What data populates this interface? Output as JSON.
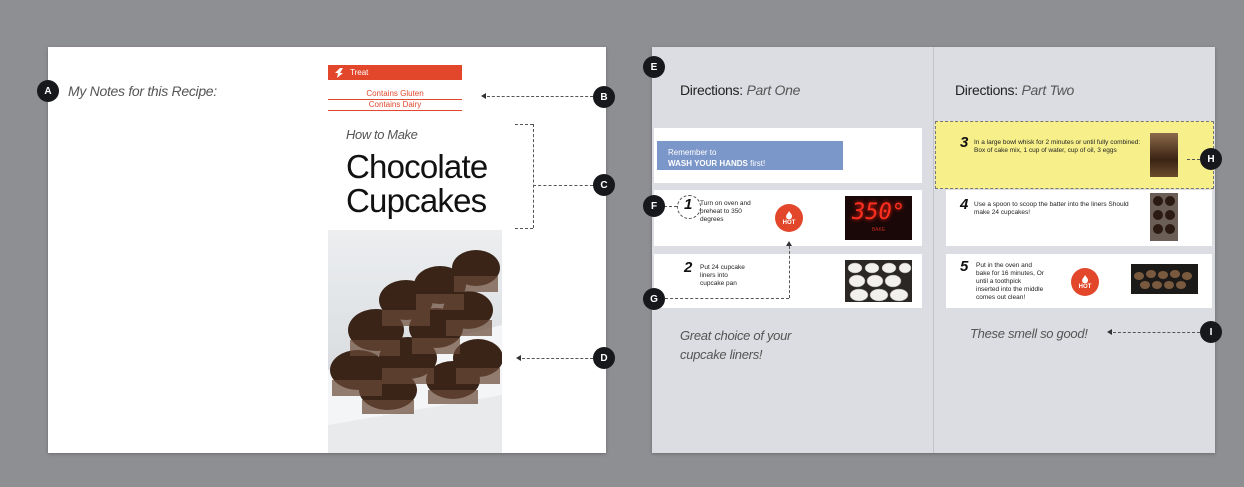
{
  "callouts": {
    "a": "A",
    "b": "B",
    "c": "C",
    "d": "D",
    "e": "E",
    "f": "F",
    "g": "G",
    "h": "H",
    "i": "I"
  },
  "left_page": {
    "notes_heading": "My Notes for this Recipe:"
  },
  "tags": {
    "treat": "Treat",
    "gluten": "Contains Gluten",
    "dairy": "Contains Dairy"
  },
  "title": {
    "how_to": "How to Make",
    "line1": "Chocolate",
    "line2": "Cupcakes"
  },
  "directions_one": {
    "title_main": "Directions:",
    "title_part": "Part One",
    "remember_line1": "Remember to",
    "remember_bold": "WASH YOUR HANDS",
    "remember_rest": "first!",
    "step1_num": "1",
    "step1_text": "Turn on oven and preheat to 350 degrees",
    "hot": "HOT",
    "oven_display": "350°",
    "oven_sub": "BAKE",
    "step2_num": "2",
    "step2_text": "Put 24 cupcake liners into cupcake pan",
    "note": "Great choice of your cupcake liners!"
  },
  "directions_two": {
    "title_main": "Directions:",
    "title_part": "Part Two",
    "step3_num": "3",
    "step3_text": "In a large bowl whisk for 2 minutes or until fully combined: Box of cake mix, 1   cup of water,   cup of oil, 3 eggs",
    "step4_num": "4",
    "step4_text": "Use a spoon to scoop the batter into the liners Should make 24 cupcakes!",
    "step5_num": "5",
    "step5_text": "Put in the oven and bake for 16 minutes, Or until a toothpick inserted into the middle comes out clean!",
    "hot": "HOT",
    "note": "These smell so good!"
  },
  "colors": {
    "accent_red": "#e2472b",
    "highlight_yellow": "#f7f08a",
    "remember_blue": "#7b96c8"
  }
}
